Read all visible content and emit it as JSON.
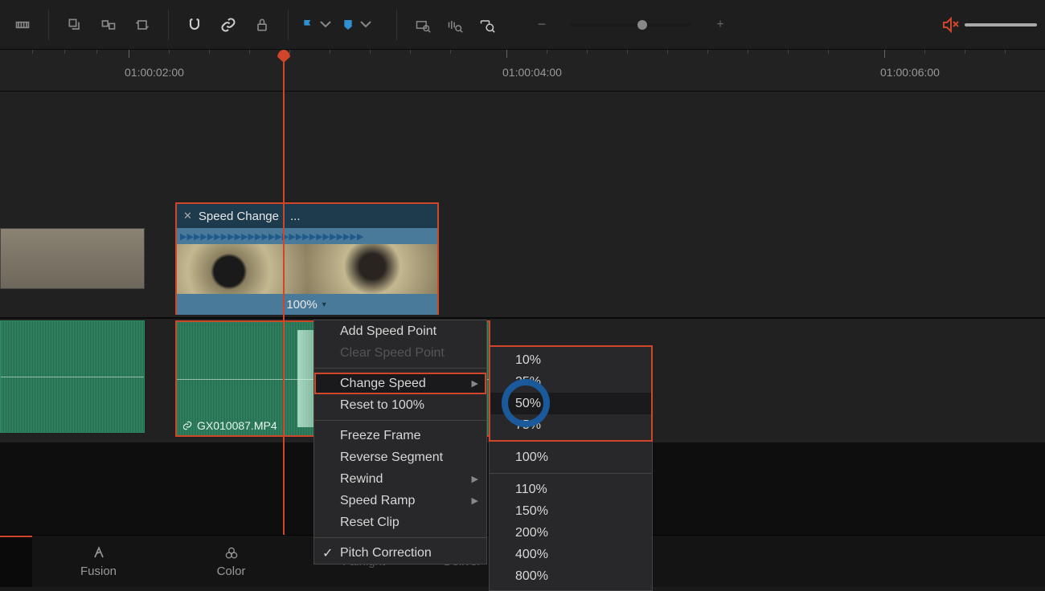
{
  "ruler": {
    "ticks": [
      {
        "pos": 160,
        "label": "01:00:02:00"
      },
      {
        "pos": 630,
        "label": "01:00:04:00"
      },
      {
        "pos": 1100,
        "label": "01:00:06:00"
      }
    ]
  },
  "clip": {
    "title": "Speed Change",
    "ellipsis": "...",
    "speed_label": "100%"
  },
  "audio": {
    "filename": "GX010087.MP4"
  },
  "menu": {
    "add_speed_point": "Add Speed Point",
    "clear_speed_point": "Clear Speed Point",
    "change_speed": "Change Speed",
    "reset_100": "Reset to 100%",
    "freeze_frame": "Freeze Frame",
    "reverse_segment": "Reverse Segment",
    "rewind": "Rewind",
    "speed_ramp": "Speed Ramp",
    "reset_clip": "Reset Clip",
    "pitch_correction": "Pitch Correction"
  },
  "submenu": {
    "p10": "10%",
    "p25": "25%",
    "p50": "50%",
    "p75": "75%",
    "p100": "100%",
    "p110": "110%",
    "p150": "150%",
    "p200": "200%",
    "p400": "400%",
    "p800": "800%"
  },
  "footer": {
    "fusion": "Fusion",
    "color": "Color",
    "fairlight": "Fairlight",
    "deliver": "Deliver"
  }
}
